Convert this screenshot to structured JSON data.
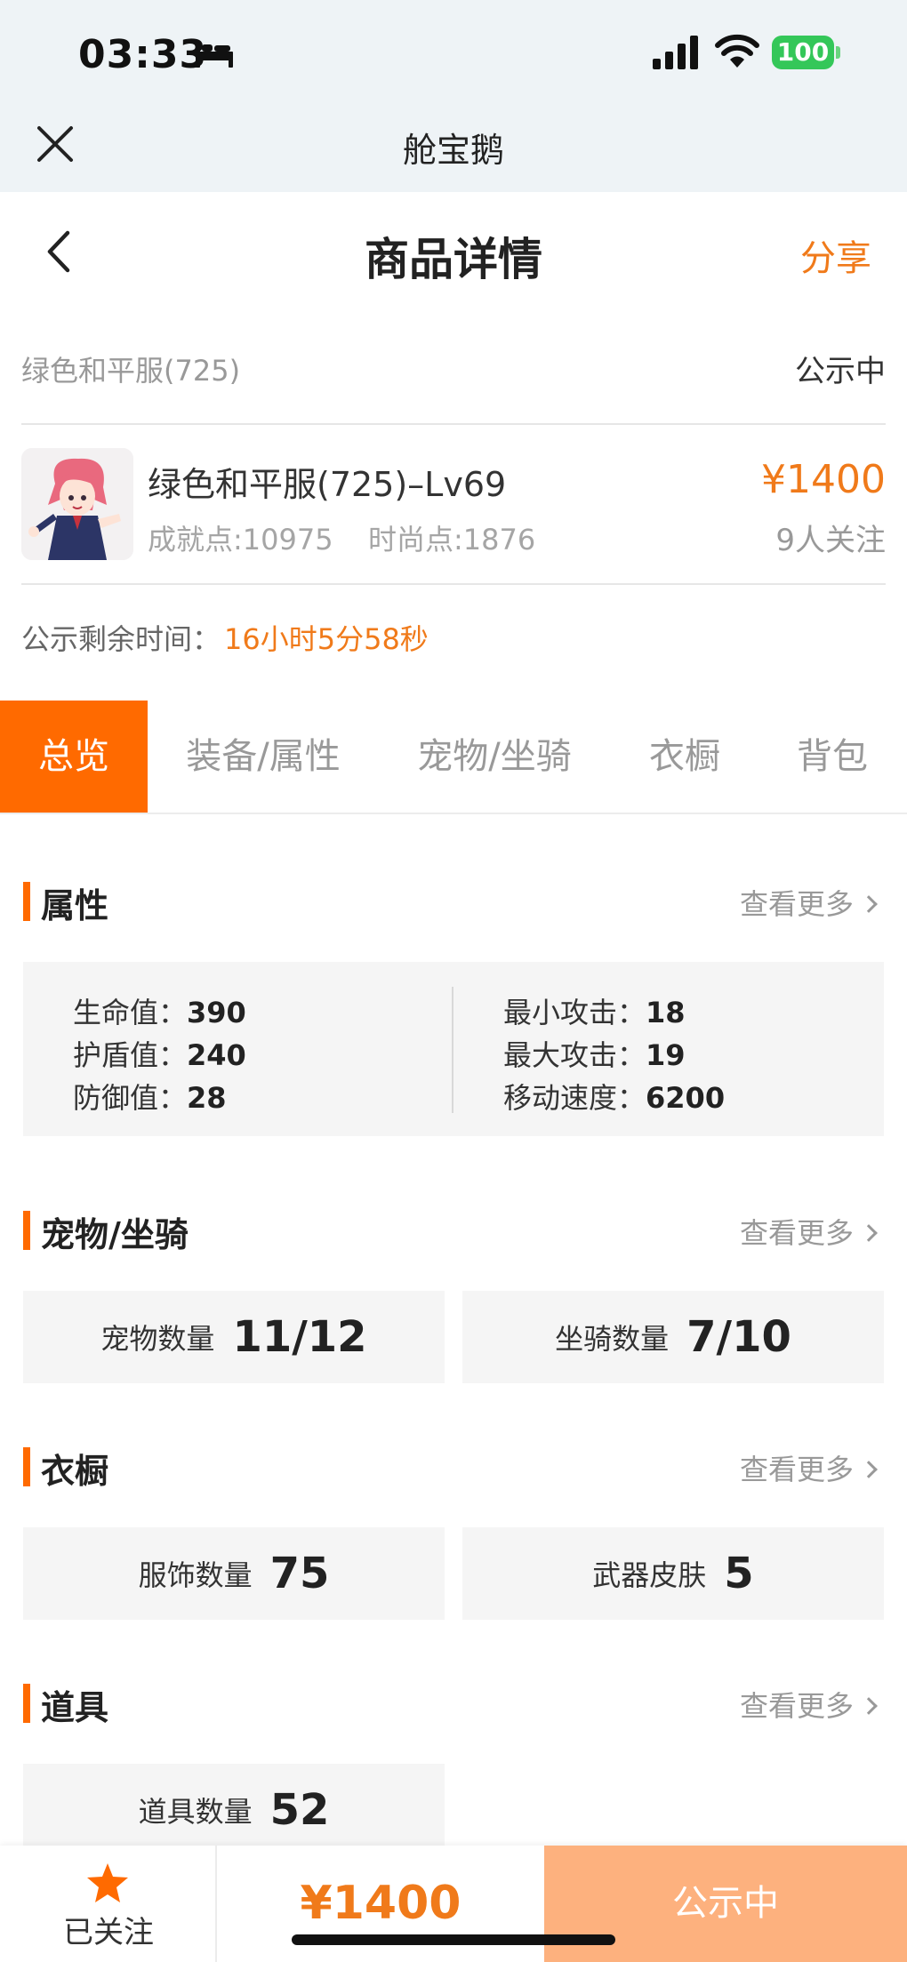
{
  "status": {
    "time": "03:33",
    "battery": "100"
  },
  "mini_app": {
    "title": "舱宝鹅"
  },
  "header": {
    "title": "商品详情",
    "share": "分享"
  },
  "sub_header": {
    "server": "绿色和平服(725)",
    "state": "公示中"
  },
  "product": {
    "name": "绿色和平服(725)–Lv69",
    "achievement": "成就点:10975",
    "fashion": "时尚点:1876",
    "price": "¥1400",
    "followers": "9人关注"
  },
  "remaining": {
    "label": "公示剩余时间：",
    "value": "16小时5分58秒"
  },
  "tabs": [
    {
      "label": "总览",
      "active": true
    },
    {
      "label": "装备/属性"
    },
    {
      "label": "宠物/坐骑"
    },
    {
      "label": "衣橱"
    },
    {
      "label": "背包"
    }
  ],
  "more_label": "查看更多",
  "attributes": {
    "title": "属性",
    "left": [
      {
        "label": "生命值：",
        "value": "390"
      },
      {
        "label": "护盾值：",
        "value": "240"
      },
      {
        "label": "防御值：",
        "value": "28"
      }
    ],
    "right": [
      {
        "label": "最小攻击：",
        "value": "18"
      },
      {
        "label": "最大攻击：",
        "value": "19"
      },
      {
        "label": "移动速度：",
        "value": "6200"
      }
    ]
  },
  "pets": {
    "title": "宠物/坐骑",
    "items": [
      {
        "label": "宠物数量",
        "value": "11/12"
      },
      {
        "label": "坐骑数量",
        "value": "7/10"
      }
    ]
  },
  "wardrobe": {
    "title": "衣橱",
    "items": [
      {
        "label": "服饰数量",
        "value": "75"
      },
      {
        "label": "武器皮肤",
        "value": "5"
      }
    ]
  },
  "props": {
    "title": "道具",
    "items": [
      {
        "label": "道具数量",
        "value": "52"
      }
    ]
  },
  "bottom": {
    "follow": "已关注",
    "price": "¥1400",
    "cta": "公示中"
  },
  "colors": {
    "accent": "#ff6a00",
    "price": "#f07a1a",
    "cta_bg": "#fdb17e",
    "battery": "#34c759"
  }
}
